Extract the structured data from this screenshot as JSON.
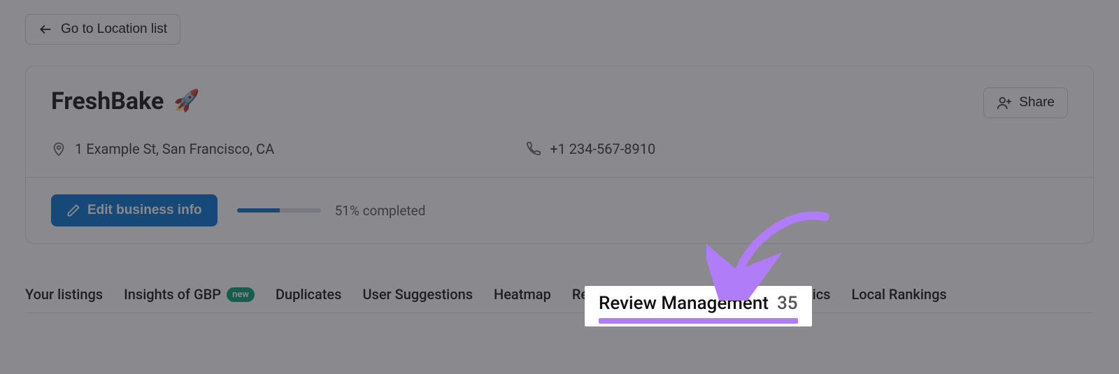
{
  "back": {
    "label": "Go to Location list"
  },
  "header": {
    "title": "FreshBake",
    "emoji": "🚀",
    "share_label": "Share"
  },
  "location": {
    "address": "1 Example St, San Francisco, CA",
    "phone": "+1 234-567-8910"
  },
  "edit": {
    "label": "Edit business info",
    "completed_label": "51% completed",
    "progress_percent": 51
  },
  "tabs": {
    "listings": "Your listings",
    "insights": "Insights of GBP",
    "new_badge": "new",
    "duplicates": "Duplicates",
    "user_suggestions": "User Suggestions",
    "heatmap": "Heatmap",
    "review_mgmt": "Review Management",
    "review_mgmt_count": "35",
    "review_analytics_partial": "iew Analytics",
    "local_rankings": "Local Rankings"
  },
  "highlight": {
    "label": "Review Management",
    "count": "35"
  }
}
